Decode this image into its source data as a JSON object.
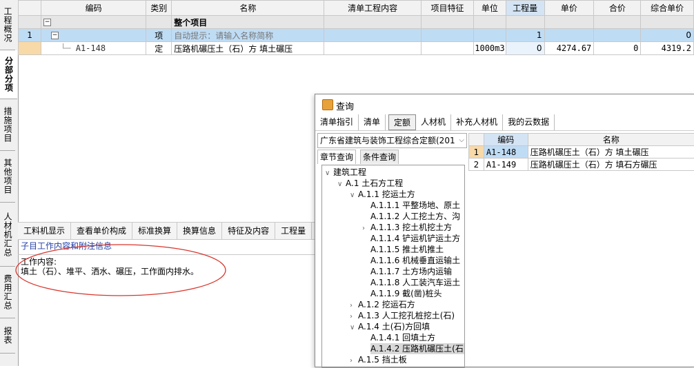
{
  "side_tabs": [
    {
      "label": "工程概况",
      "active": false
    },
    {
      "label": "分部分项",
      "active": true
    },
    {
      "label": "措施项目",
      "active": false
    },
    {
      "label": "其他项目",
      "active": false
    },
    {
      "label": "人材机汇总",
      "active": false
    },
    {
      "label": "费用汇总",
      "active": false
    },
    {
      "label": "报表",
      "active": false
    }
  ],
  "grid": {
    "headers": [
      "编码",
      "类别",
      "名称",
      "清单工程内容",
      "项目特征",
      "单位",
      "工程量",
      "单价",
      "合价",
      "综合单价"
    ],
    "group_row": {
      "name": "整个项目"
    },
    "row1": {
      "index": "1",
      "type": "项",
      "hint": "自动提示：请输入名称简称",
      "qty": "1",
      "total_price": "0"
    },
    "row2": {
      "code": "A1-148",
      "type": "定",
      "name": "压路机碾压土（石）方 填土碾压",
      "unit": "1000m3",
      "qty": "0",
      "unit_price": "4274.67",
      "total": "0",
      "total_price": "4319.2"
    }
  },
  "bottom_tabs": [
    "工料机显示",
    "查看单价构成",
    "标准换算",
    "换算信息",
    "特征及内容",
    "工程量"
  ],
  "bottom": {
    "subtitle": "子目工作内容和附注信息",
    "content_line1": "工作内容:",
    "content_line2": "填土（石）、堆平、洒水、碾压，工作面内排水。"
  },
  "dialog": {
    "title": "查询",
    "tabs": [
      "清单指引",
      "清单",
      "定额",
      "人材机",
      "补充人材机",
      "我的云数据"
    ],
    "active_tab": "定额",
    "library": "广东省建筑与装饰工程综合定额(201",
    "subtabs": [
      "章节查询",
      "条件查询"
    ],
    "tree": [
      {
        "label": "建筑工程"
      },
      {
        "label": "A.1 土石方工程"
      },
      {
        "label": "A.1.1 挖运土方"
      },
      {
        "label": "A.1.1.1 平整场地、原土"
      },
      {
        "label": "A.1.1.2 人工挖土方、沟"
      },
      {
        "label": "A.1.1.3 挖土机挖土方"
      },
      {
        "label": "A.1.1.4 铲运机铲运土方"
      },
      {
        "label": "A.1.1.5 推土机推土"
      },
      {
        "label": "A.1.1.6 机械垂直运输土"
      },
      {
        "label": "A.1.1.7 土方场内运输"
      },
      {
        "label": "A.1.1.8 人工装汽车运土"
      },
      {
        "label": "A.1.1.9 截(凿)桩头"
      },
      {
        "label": "A.1.2 挖运石方"
      },
      {
        "label": "A.1.3 人工挖孔桩挖土(石)"
      },
      {
        "label": "A.1.4 土(石)方回填"
      },
      {
        "label": "A.1.4.1 回填土方"
      },
      {
        "label": "A.1.4.2 压路机碾压土(石)"
      },
      {
        "label": "A.1.5 挡土板"
      }
    ],
    "result_headers": [
      "编码",
      "名称"
    ],
    "results": [
      {
        "index": "1",
        "code": "A1-148",
        "name": "压路机碾压土（石）方 填土碾压"
      },
      {
        "index": "2",
        "code": "A1-149",
        "name": "压路机碾压土（石）方 填石方碾压"
      }
    ]
  },
  "colors": {
    "selected_row": "#bfdcf5",
    "highlight_header": "#d4e4f4",
    "link_blue": "#2340a8",
    "annotation_red": "#d9342b"
  }
}
